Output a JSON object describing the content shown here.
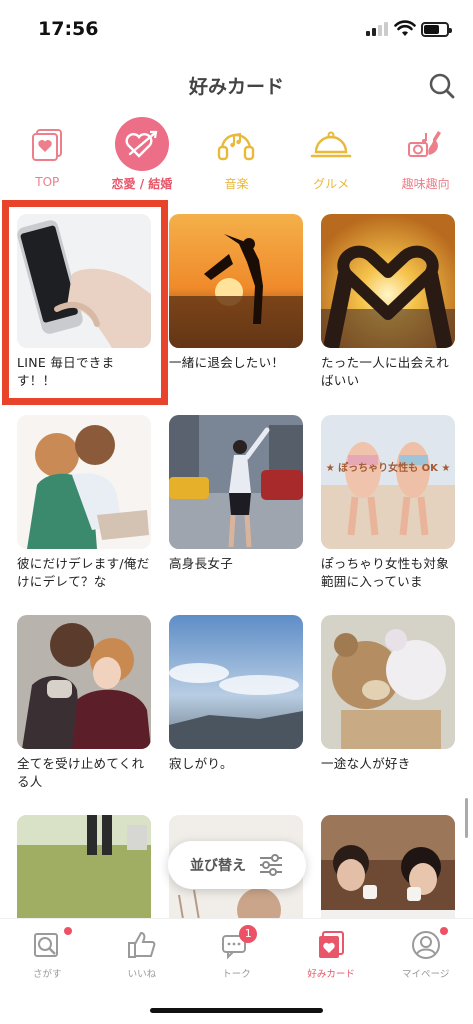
{
  "status": {
    "time": "17:56"
  },
  "header": {
    "title": "好みカード",
    "search_icon": "search-icon"
  },
  "categories": [
    {
      "label": "TOP",
      "icon": "card-heart-icon",
      "active": false
    },
    {
      "label": "恋愛 / 結婚",
      "icon": "heart-arrow-icon",
      "active": true
    },
    {
      "label": "音楽",
      "icon": "headphones-icon",
      "active": false
    },
    {
      "label": "グルメ",
      "icon": "cloche-icon",
      "active": false
    },
    {
      "label": "趣味趣向",
      "icon": "hobby-icon",
      "active": false
    }
  ],
  "cards": [
    {
      "caption": "LINE 毎日できます！！"
    },
    {
      "caption": "一緒に退会したい！"
    },
    {
      "caption": "たった一人に出会えればいい"
    },
    {
      "caption": "彼にだけデレます/俺だけにデレて？な"
    },
    {
      "caption": "高身長女子"
    },
    {
      "caption": "ぽっちゃり女性も対象範囲に入っていま",
      "banner": "★ ぽっちゃり女性も OK ★"
    },
    {
      "caption": "全てを受け止めてくれる人"
    },
    {
      "caption": "寂しがり。"
    },
    {
      "caption": "一途な人が好き"
    },
    {
      "caption": ""
    },
    {
      "caption": ""
    },
    {
      "caption": ""
    }
  ],
  "sort_button": {
    "label": "並び替え",
    "icon": "sliders-icon"
  },
  "tabs": [
    {
      "label": "さがす",
      "icon": "search-card-icon",
      "dot": true
    },
    {
      "label": "いいね",
      "icon": "thumbs-up-icon",
      "dot": false
    },
    {
      "label": "トーク",
      "icon": "chat-icon",
      "badge": "1"
    },
    {
      "label": "好みカード",
      "icon": "card-heart-icon",
      "active": true
    },
    {
      "label": "マイページ",
      "icon": "user-icon",
      "dot": true
    }
  ],
  "colors": {
    "accent": "#e8566a",
    "highlight_box": "#e8432b",
    "gold": "#e9b93c"
  }
}
